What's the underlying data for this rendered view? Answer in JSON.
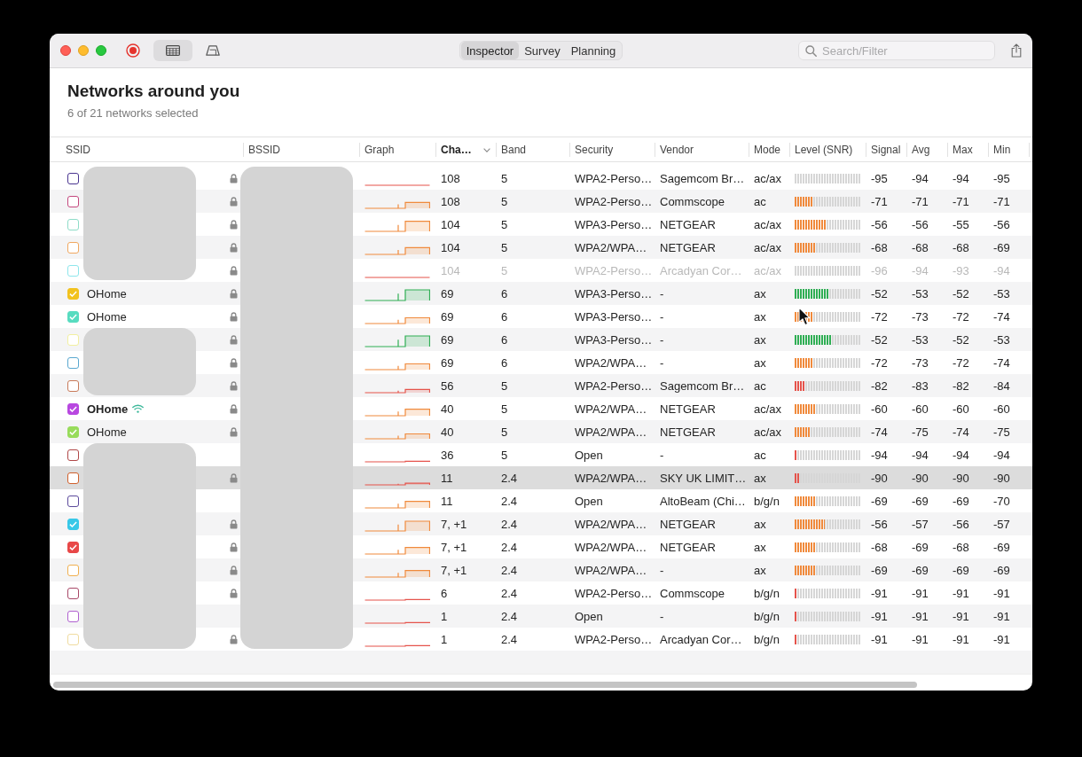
{
  "window": {
    "toolbar": {
      "view_buttons": [
        {
          "kind": "table",
          "selected": true
        },
        {
          "kind": "perspective",
          "selected": false
        }
      ],
      "tabs": [
        {
          "label": "Inspector",
          "selected": true
        },
        {
          "label": "Survey",
          "selected": false
        },
        {
          "label": "Planning",
          "selected": false
        }
      ],
      "search": {
        "placeholder": "Search/Filter"
      }
    }
  },
  "header": {
    "title": "Networks around you",
    "subtitle": "6 of 21 networks selected"
  },
  "table": {
    "columns": [
      {
        "label": "SSID",
        "sorted": false
      },
      {
        "label": "BSSID",
        "sorted": false
      },
      {
        "label": "Graph",
        "sorted": false
      },
      {
        "label": "Cha…",
        "sorted": true
      },
      {
        "label": "Band",
        "sorted": false
      },
      {
        "label": "Security",
        "sorted": false
      },
      {
        "label": "Vendor",
        "sorted": false
      },
      {
        "label": "Mode",
        "sorted": false
      },
      {
        "label": "Level (SNR)",
        "sorted": false
      },
      {
        "label": "Signal",
        "sorted": false
      },
      {
        "label": "Avg",
        "sorted": false
      },
      {
        "label": "Max",
        "sorted": false
      },
      {
        "label": "Min",
        "sorted": false
      }
    ],
    "bssid_redacted": true,
    "rows": [
      {
        "color": "#4a3590",
        "checked": false,
        "connected": false,
        "locked": true,
        "channel": "108",
        "band": "5",
        "security": "WPA2-Perso…",
        "vendor": "Sagemcom Br…",
        "mode": "ac/ax",
        "level": 0,
        "signal": "-95",
        "avg": "-94",
        "max": "-94",
        "min": "-95",
        "dimmed": false,
        "selected": false,
        "hovered": false
      },
      {
        "color": "#c4487e",
        "checked": false,
        "connected": false,
        "locked": true,
        "channel": "108",
        "band": "5",
        "security": "WPA2-Perso…",
        "vendor": "Commscope",
        "mode": "ac",
        "level": 0.28,
        "signal": "-71",
        "avg": "-71",
        "max": "-71",
        "min": "-71",
        "dimmed": false,
        "selected": false,
        "hovered": false
      },
      {
        "color": "#8fdcc8",
        "checked": false,
        "connected": false,
        "locked": true,
        "channel": "104",
        "band": "5",
        "security": "WPA3-Perso…",
        "vendor": "NETGEAR",
        "mode": "ac/ax",
        "level": 0.47,
        "signal": "-56",
        "avg": "-56",
        "max": "-55",
        "min": "-56",
        "dimmed": false,
        "selected": false,
        "hovered": false
      },
      {
        "color": "#f0a860",
        "checked": false,
        "connected": false,
        "locked": true,
        "channel": "104",
        "band": "5",
        "security": "WPA2/WPA…",
        "vendor": "NETGEAR",
        "mode": "ac/ax",
        "level": 0.32,
        "signal": "-68",
        "avg": "-68",
        "max": "-68",
        "min": "-69",
        "dimmed": false,
        "selected": false,
        "hovered": false
      },
      {
        "color": "#8ee6ec",
        "checked": false,
        "connected": false,
        "locked": true,
        "channel": "104",
        "band": "5",
        "security": "WPA2-Perso…",
        "vendor": "Arcadyan Cor…",
        "mode": "ac/ax",
        "level": 0,
        "signal": "-96",
        "avg": "-94",
        "max": "-93",
        "min": "-94",
        "dimmed": true,
        "selected": false,
        "hovered": false
      },
      {
        "color": "#f2c21e",
        "checked": true,
        "ssid": "OHome",
        "connected": false,
        "locked": true,
        "channel": "69",
        "band": "6",
        "security": "WPA3-Perso…",
        "vendor": "-",
        "mode": "ax",
        "level": 0.52,
        "signal": "-52",
        "avg": "-53",
        "max": "-52",
        "min": "-53",
        "dimmed": false,
        "selected": false,
        "hovered": false
      },
      {
        "color": "#58dcc0",
        "checked": true,
        "ssid": "OHome",
        "connected": false,
        "locked": true,
        "channel": "69",
        "band": "6",
        "security": "WPA3-Perso…",
        "vendor": "-",
        "mode": "ax",
        "level": 0.27,
        "signal": "-72",
        "avg": "-73",
        "max": "-72",
        "min": "-74",
        "dimmed": false,
        "selected": false,
        "hovered": true
      },
      {
        "color": "#f2f0a0",
        "checked": false,
        "connected": false,
        "locked": true,
        "channel": "69",
        "band": "6",
        "security": "WPA3-Perso…",
        "vendor": "-",
        "mode": "ax",
        "level": 0.55,
        "signal": "-52",
        "avg": "-53",
        "max": "-52",
        "min": "-53",
        "dimmed": false,
        "selected": false,
        "hovered": false
      },
      {
        "color": "#5aa8d0",
        "checked": false,
        "connected": false,
        "locked": true,
        "channel": "69",
        "band": "6",
        "security": "WPA2/WPA…",
        "vendor": "-",
        "mode": "ax",
        "level": 0.27,
        "signal": "-72",
        "avg": "-73",
        "max": "-72",
        "min": "-74",
        "dimmed": false,
        "selected": false,
        "hovered": false
      },
      {
        "color": "#c87a5a",
        "checked": false,
        "connected": false,
        "locked": true,
        "channel": "56",
        "band": "5",
        "security": "WPA2-Perso…",
        "vendor": "Sagemcom Br…",
        "mode": "ac",
        "level": 0.15,
        "signal": "-82",
        "avg": "-83",
        "max": "-82",
        "min": "-84",
        "dimmed": false,
        "selected": false,
        "hovered": false
      },
      {
        "color": "#b848e0",
        "checked": true,
        "ssid": "OHome",
        "connected": true,
        "locked": true,
        "channel": "40",
        "band": "5",
        "security": "WPA2/WPA…",
        "vendor": "NETGEAR",
        "mode": "ac/ax",
        "level": 0.31,
        "signal": "-60",
        "avg": "-60",
        "max": "-60",
        "min": "-60",
        "dimmed": false,
        "selected": false,
        "hovered": false
      },
      {
        "color": "#98dc5c",
        "checked": true,
        "ssid": "OHome",
        "connected": false,
        "locked": true,
        "channel": "40",
        "band": "5",
        "security": "WPA2/WPA…",
        "vendor": "NETGEAR",
        "mode": "ac/ax",
        "level": 0.23,
        "signal": "-74",
        "avg": "-75",
        "max": "-74",
        "min": "-75",
        "dimmed": false,
        "selected": false,
        "hovered": false
      },
      {
        "color": "#b04848",
        "checked": false,
        "connected": false,
        "locked": false,
        "channel": "36",
        "band": "5",
        "security": "Open",
        "vendor": "-",
        "mode": "ac",
        "level": 0.03,
        "signal": "-94",
        "avg": "-94",
        "max": "-94",
        "min": "-94",
        "dimmed": false,
        "selected": false,
        "hovered": false
      },
      {
        "color": "#d0602c",
        "checked": false,
        "connected": false,
        "locked": true,
        "channel": "11",
        "band": "2.4",
        "security": "WPA2/WPA…",
        "vendor": "SKY UK LIMIT…",
        "mode": "ax",
        "level": 0.08,
        "signal": "-90",
        "avg": "-90",
        "max": "-90",
        "min": "-90",
        "dimmed": false,
        "selected": true,
        "hovered": false
      },
      {
        "color": "#5c4a9c",
        "checked": false,
        "connected": false,
        "locked": false,
        "channel": "11",
        "band": "2.4",
        "security": "Open",
        "vendor": "AltoBeam (Chi…",
        "mode": "b/g/n",
        "level": 0.31,
        "signal": "-69",
        "avg": "-69",
        "max": "-69",
        "min": "-70",
        "dimmed": false,
        "selected": false,
        "hovered": false
      },
      {
        "color": "#38c8e8",
        "checked": true,
        "connected": false,
        "locked": true,
        "channel": "7, +1",
        "band": "2.4",
        "security": "WPA2/WPA…",
        "vendor": "NETGEAR",
        "mode": "ax",
        "level": 0.46,
        "signal": "-56",
        "avg": "-57",
        "max": "-56",
        "min": "-57",
        "dimmed": false,
        "selected": false,
        "hovered": false
      },
      {
        "color": "#e84848",
        "checked": true,
        "connected": false,
        "locked": true,
        "channel": "7, +1",
        "band": "2.4",
        "security": "WPA2/WPA…",
        "vendor": "NETGEAR",
        "mode": "ax",
        "level": 0.31,
        "signal": "-68",
        "avg": "-69",
        "max": "-68",
        "min": "-69",
        "dimmed": false,
        "selected": false,
        "hovered": false
      },
      {
        "color": "#f0b050",
        "checked": false,
        "connected": false,
        "locked": true,
        "channel": "7, +1",
        "band": "2.4",
        "security": "WPA2/WPA…",
        "vendor": "-",
        "mode": "ax",
        "level": 0.31,
        "signal": "-69",
        "avg": "-69",
        "max": "-69",
        "min": "-69",
        "dimmed": false,
        "selected": false,
        "hovered": false
      },
      {
        "color": "#a84868",
        "checked": false,
        "connected": false,
        "locked": true,
        "channel": "6",
        "band": "2.4",
        "security": "WPA2-Perso…",
        "vendor": "Commscope",
        "mode": "b/g/n",
        "level": 0.03,
        "signal": "-91",
        "avg": "-91",
        "max": "-91",
        "min": "-91",
        "dimmed": false,
        "selected": false,
        "hovered": false
      },
      {
        "color": "#b060d0",
        "checked": false,
        "connected": false,
        "locked": false,
        "channel": "1",
        "band": "2.4",
        "security": "Open",
        "vendor": "-",
        "mode": "b/g/n",
        "level": 0.03,
        "signal": "-91",
        "avg": "-91",
        "max": "-91",
        "min": "-91",
        "dimmed": false,
        "selected": false,
        "hovered": false
      },
      {
        "color": "#f0dca0",
        "checked": false,
        "connected": false,
        "locked": true,
        "channel": "1",
        "band": "2.4",
        "security": "WPA2-Perso…",
        "vendor": "Arcadyan Cor…",
        "mode": "b/g/n",
        "level": 0.03,
        "signal": "-91",
        "avg": "-91",
        "max": "-91",
        "min": "-91",
        "dimmed": false,
        "selected": false,
        "hovered": false
      }
    ]
  }
}
